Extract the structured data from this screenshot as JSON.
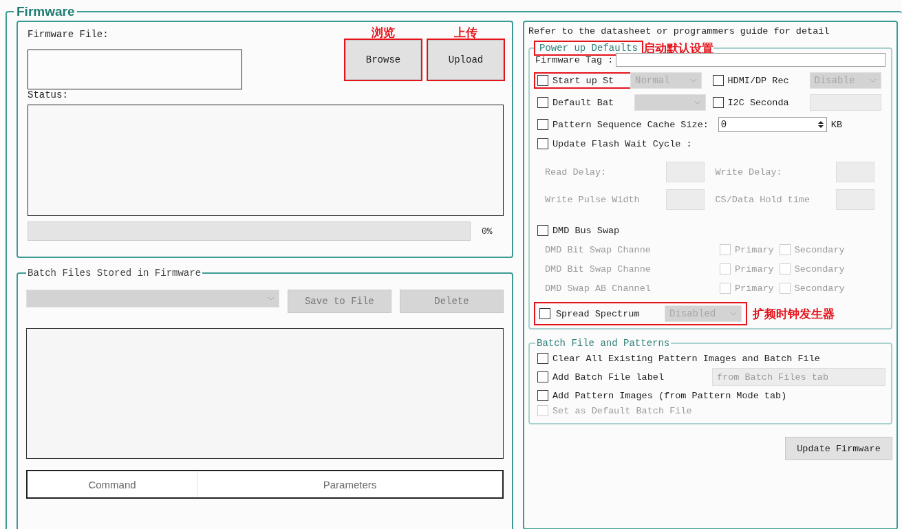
{
  "title": "Firmware",
  "firmware": {
    "file_label": "Firmware File:",
    "buttons": [
      {
        "label": "Browse",
        "highlighted": true,
        "annotation": "浏览"
      },
      {
        "label": "Upload",
        "highlighted": true,
        "annotation": "上传"
      }
    ],
    "status_label": "Status:",
    "progress": {
      "level": 0,
      "text": "0%"
    }
  },
  "batch_files": {
    "title": "Batch Files Stored in Firmware",
    "dropdown": {
      "disabled": true
    },
    "buttons": [
      {
        "label": "Save to File",
        "disabled": true
      },
      {
        "label": "Delete",
        "disabled": true
      }
    ],
    "table": {
      "columns": [
        "Command",
        "Parameters"
      ]
    }
  },
  "note": "Refer to the datasheet or programmers guide for detail",
  "power_up": {
    "title": "Power up Defaults",
    "highlighted": true,
    "annotation": "启动默认设置",
    "tag_label": "Firmware Tag :",
    "pairs": [
      [
        {
          "label": "Start up St",
          "checked": false,
          "highlighted": true,
          "kind": "dropdown",
          "value": "Normal",
          "disabled": true
        },
        {
          "label": "HDMI/DP Rec",
          "checked": false,
          "highlighted": false,
          "kind": "dropdown",
          "value": "Disable",
          "disabled": true
        }
      ],
      [
        {
          "label": "Default Bat",
          "checked": false,
          "highlighted": false,
          "kind": "dropdown",
          "disabled": true
        },
        {
          "label": "I2C Seconda",
          "checked": false,
          "highlighted": false,
          "kind": "input",
          "disabled": true
        }
      ]
    ],
    "cache": {
      "label": "Pattern Sequence Cache Size:",
      "checked": false,
      "value": "0",
      "unit": "KB"
    },
    "flash": {
      "label": "Update Flash Wait Cycle :",
      "checked": false
    },
    "delays": [
      {
        "label": "Read Delay:",
        "disabled": true
      },
      {
        "label": "Write Delay:",
        "disabled": true
      },
      {
        "label": "Write Pulse Width",
        "disabled": true
      },
      {
        "label": "CS/Data Hold time",
        "disabled": true
      }
    ],
    "bus_swap": {
      "label": "DMD Bus Swap",
      "checked": false
    },
    "channels": [
      {
        "label": "DMD Bit Swap Channe",
        "disabled": true,
        "options": [
          {
            "label": "Primary",
            "checked": false
          },
          {
            "label": "Secondary",
            "checked": false
          }
        ]
      },
      {
        "label": "DMD Bit Swap Channe",
        "disabled": true,
        "options": [
          {
            "label": "Primary",
            "checked": false
          },
          {
            "label": "Secondary",
            "checked": false
          }
        ]
      },
      {
        "label": "DMD Swap AB Channel",
        "disabled": true,
        "options": [
          {
            "label": "Primary",
            "checked": false
          },
          {
            "label": "Secondary",
            "checked": false
          }
        ]
      }
    ],
    "spread": {
      "label": "Spread Spectrum",
      "checked": false,
      "value": "Disabled",
      "disabled": true,
      "highlighted": true,
      "annotation": "扩频时钟发生器"
    }
  },
  "batch_patterns": {
    "title": "Batch File and Patterns",
    "items": [
      {
        "label": "Clear All Existing Pattern Images and Batch File",
        "checked": false,
        "disabled": false
      },
      {
        "label": "Add Batch File label",
        "checked": false,
        "disabled": false,
        "field": "from Batch Files tab"
      },
      {
        "label": "Add Pattern Images (from Pattern Mode tab)",
        "checked": false,
        "disabled": false
      },
      {
        "label": "Set as Default Batch File",
        "checked": false,
        "disabled": true
      }
    ]
  },
  "update_button": "Update Firmware"
}
